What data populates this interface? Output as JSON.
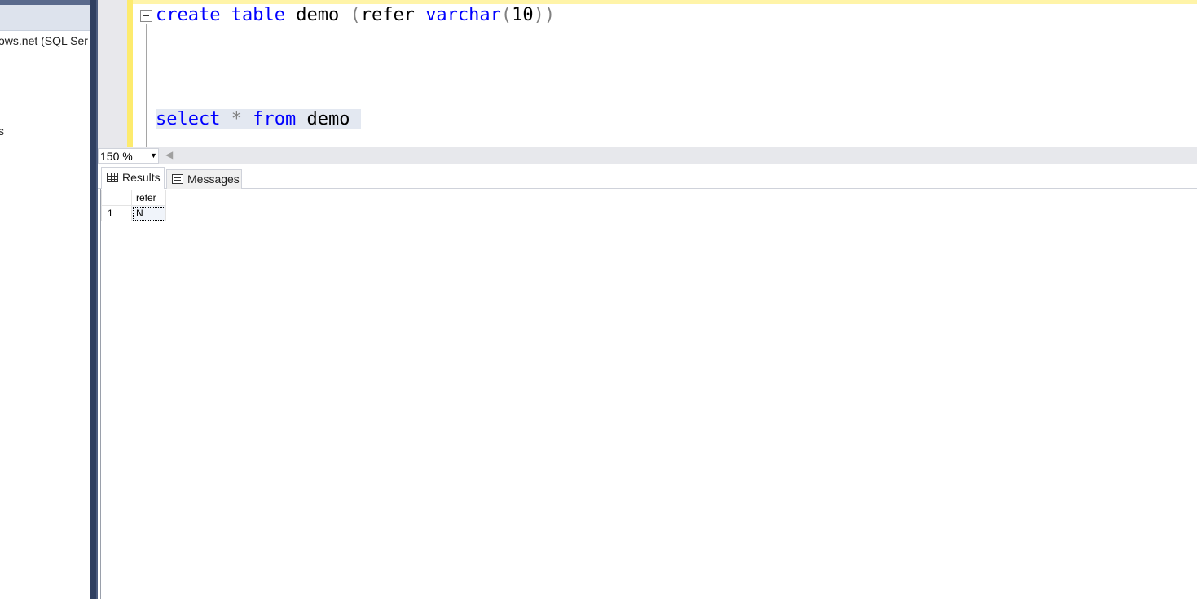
{
  "explorer": {
    "nodes": [
      "ows.net (SQL Ser",
      "s"
    ]
  },
  "editor": {
    "line1": {
      "create": "create",
      "table": "table",
      "demo": "demo",
      "open_paren": "(",
      "refer": "refer",
      "varchar": "varchar",
      "open_paren2": "(",
      "size": "10",
      "close_parens": "))"
    },
    "line2": {
      "select": "select",
      "star": "*",
      "from": "from",
      "demo": "demo"
    }
  },
  "zoom": {
    "value": "150 %"
  },
  "tabs": {
    "results": "Results",
    "messages": "Messages"
  },
  "results": {
    "columns": [
      "refer"
    ],
    "rows": [
      {
        "num": "1",
        "refer": "N"
      }
    ]
  },
  "colors": {
    "keyword": "#0000ff",
    "operator": "#808080",
    "change_bar": "#fdeb6e",
    "splitter": "#2f3f61"
  }
}
